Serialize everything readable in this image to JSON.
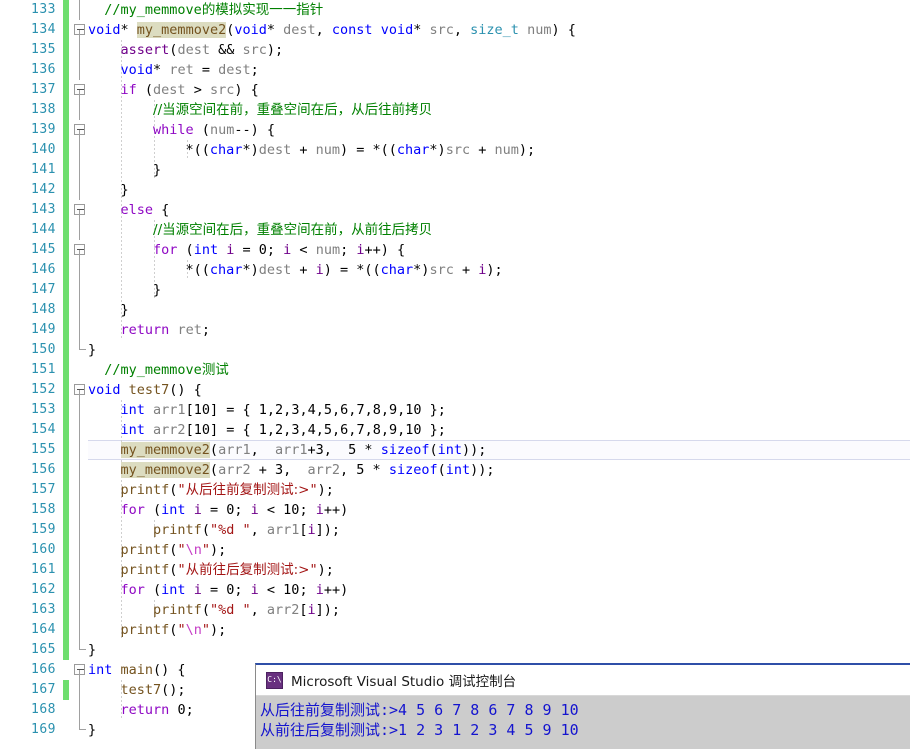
{
  "app": {
    "name": "visual-studio-code-editor",
    "accent_line_number_color": "#2B91AF",
    "change_bar_color": "#6EDE6E"
  },
  "editor": {
    "first_line_number": 133,
    "last_line_number": 169,
    "current_line_number": 155,
    "highlighted_symbol": "my_memmove2",
    "lines": [
      {
        "n": 133,
        "changed": true,
        "fold": "vline",
        "indent_guides": [],
        "html": "  <span class='cmt'>//my_memmove<span class='cjk'>的模拟实现一一指针</span></span>"
      },
      {
        "n": 134,
        "changed": true,
        "fold": "box",
        "indent_guides": [],
        "html": "<span class='kw'>void</span><span class='op'>*</span> <span class='fnhl'>my_memmove2</span>(<span class='kw'>void</span><span class='op'>*</span> <span class='var'>dest</span>, <span class='kw'>const</span> <span class='kw'>void</span><span class='op'>*</span> <span class='var'>src</span>, <span class='type'>size_t</span> <span class='var'>num</span>) {"
      },
      {
        "n": 135,
        "changed": true,
        "fold": "vline",
        "indent_guides": [
          1
        ],
        "html": "    <span class='macro'>assert</span>(<span class='var'>dest</span> &amp;&amp; <span class='var'>src</span>);"
      },
      {
        "n": 136,
        "changed": true,
        "fold": "vline",
        "indent_guides": [
          1
        ],
        "html": "    <span class='kw'>void</span><span class='op'>*</span> <span class='var'>ret</span> = <span class='var'>dest</span>;"
      },
      {
        "n": 137,
        "changed": true,
        "fold": "box",
        "indent_guides": [
          1
        ],
        "html": "    <span class='ctl'>if</span> (<span class='var'>dest</span> &gt; <span class='var'>src</span>) {"
      },
      {
        "n": 138,
        "changed": true,
        "fold": "vline",
        "indent_guides": [
          1,
          2
        ],
        "html": "        <span class='cmt cjk'>//当源空间在前，重叠空间在后，从后往前拷贝</span>"
      },
      {
        "n": 139,
        "changed": true,
        "fold": "box",
        "indent_guides": [
          1,
          2
        ],
        "html": "        <span class='ctl'>while</span> (<span class='var'>num</span>--) {"
      },
      {
        "n": 140,
        "changed": true,
        "fold": "vline",
        "indent_guides": [
          1,
          2,
          3
        ],
        "html": "            *((<span class='kw'>char</span>*)<span class='var'>dest</span> + <span class='var'>num</span>) = *((<span class='kw'>char</span>*)<span class='var'>src</span> + <span class='var'>num</span>);"
      },
      {
        "n": 141,
        "changed": true,
        "fold": "vline",
        "indent_guides": [
          1,
          2
        ],
        "html": "        }"
      },
      {
        "n": 142,
        "changed": true,
        "fold": "vline",
        "indent_guides": [
          1
        ],
        "html": "    }"
      },
      {
        "n": 143,
        "changed": true,
        "fold": "box",
        "indent_guides": [
          1
        ],
        "html": "    <span class='ctl'>else</span> {"
      },
      {
        "n": 144,
        "changed": true,
        "fold": "vline",
        "indent_guides": [
          1,
          2
        ],
        "html": "        <span class='cmt cjk'>//当源空间在后，重叠空间在前，从前往后拷贝</span>"
      },
      {
        "n": 145,
        "changed": true,
        "fold": "box",
        "indent_guides": [
          1,
          2
        ],
        "html": "        <span class='ctl'>for</span> (<span class='kw'>int</span> <span class='loc'>i</span> = <span class='num'>0</span>; <span class='loc'>i</span> &lt; <span class='var'>num</span>; <span class='loc'>i</span>++) {"
      },
      {
        "n": 146,
        "changed": true,
        "fold": "vline",
        "indent_guides": [
          1,
          2,
          3
        ],
        "html": "            *((<span class='kw'>char</span>*)<span class='var'>dest</span> + <span class='loc'>i</span>) = *((<span class='kw'>char</span>*)<span class='var'>src</span> + <span class='loc'>i</span>);"
      },
      {
        "n": 147,
        "changed": true,
        "fold": "vline",
        "indent_guides": [
          1,
          2
        ],
        "html": "        }"
      },
      {
        "n": 148,
        "changed": true,
        "fold": "vline",
        "indent_guides": [
          1
        ],
        "html": "    }"
      },
      {
        "n": 149,
        "changed": true,
        "fold": "vline",
        "indent_guides": [
          1
        ],
        "html": "    <span class='ctl'>return</span> <span class='var'>ret</span>;"
      },
      {
        "n": 150,
        "changed": true,
        "fold": "end",
        "indent_guides": [],
        "html": "}"
      },
      {
        "n": 151,
        "changed": true,
        "fold": "none",
        "indent_guides": [],
        "html": "  <span class='cmt'>//my_memmove<span class='cjk'>测试</span></span>"
      },
      {
        "n": 152,
        "changed": true,
        "fold": "box",
        "indent_guides": [],
        "html": "<span class='kw'>void</span> <span class='fn'>test7</span>() {"
      },
      {
        "n": 153,
        "changed": true,
        "fold": "vline",
        "indent_guides": [
          1
        ],
        "html": "    <span class='kw'>int</span> <span class='var'>arr1</span>[<span class='num'>10</span>] = { <span class='num'>1</span>,<span class='num'>2</span>,<span class='num'>3</span>,<span class='num'>4</span>,<span class='num'>5</span>,<span class='num'>6</span>,<span class='num'>7</span>,<span class='num'>8</span>,<span class='num'>9</span>,<span class='num'>10</span> };"
      },
      {
        "n": 154,
        "changed": true,
        "fold": "vline",
        "indent_guides": [
          1
        ],
        "html": "    <span class='kw'>int</span> <span class='var'>arr2</span>[<span class='num'>10</span>] = { <span class='num'>1</span>,<span class='num'>2</span>,<span class='num'>3</span>,<span class='num'>4</span>,<span class='num'>5</span>,<span class='num'>6</span>,<span class='num'>7</span>,<span class='num'>8</span>,<span class='num'>9</span>,<span class='num'>10</span> };"
      },
      {
        "n": 155,
        "changed": true,
        "fold": "vline",
        "indent_guides": [
          1
        ],
        "html": "    <span class='fnhl'>my_memmove2</span>(<span class='var'>arr1</span>,  <span class='var'>arr1</span>+<span class='num'>3</span>,  <span class='num'>5</span> * <span class='kw'>sizeof</span>(<span class='kw'>int</span>));"
      },
      {
        "n": 156,
        "changed": true,
        "fold": "vline",
        "indent_guides": [
          1
        ],
        "html": "    <span class='fnhl'>my_memmove2</span>(<span class='var'>arr2</span> + <span class='num'>3</span>,  <span class='var'>arr2</span>, <span class='num'>5</span> * <span class='kw'>sizeof</span>(<span class='kw'>int</span>));"
      },
      {
        "n": 157,
        "changed": true,
        "fold": "vline",
        "indent_guides": [
          1
        ],
        "html": "    <span class='fn'>printf</span>(<span class='str'>\"<span class='cjk'>从后往前复制测试:&gt;</span>\"</span>);"
      },
      {
        "n": 158,
        "changed": true,
        "fold": "vline",
        "indent_guides": [
          1
        ],
        "html": "    <span class='ctl'>for</span> (<span class='kw'>int</span> <span class='loc'>i</span> = <span class='num'>0</span>; <span class='loc'>i</span> &lt; <span class='num'>10</span>; <span class='loc'>i</span>++)"
      },
      {
        "n": 159,
        "changed": true,
        "fold": "vline",
        "indent_guides": [
          1,
          2
        ],
        "html": "        <span class='fn'>printf</span>(<span class='str'>\"%d \"</span>, <span class='var'>arr1</span>[<span class='loc'>i</span>]);"
      },
      {
        "n": 160,
        "changed": true,
        "fold": "vline",
        "indent_guides": [
          1
        ],
        "html": "    <span class='fn'>printf</span>(<span class='str'>\"<span class='esc'>\\n</span>\"</span>);"
      },
      {
        "n": 161,
        "changed": true,
        "fold": "vline",
        "indent_guides": [
          1
        ],
        "html": "    <span class='fn'>printf</span>(<span class='str'>\"<span class='cjk'>从前往后复制测试:&gt;</span>\"</span>);"
      },
      {
        "n": 162,
        "changed": true,
        "fold": "vline",
        "indent_guides": [
          1
        ],
        "html": "    <span class='ctl'>for</span> (<span class='kw'>int</span> <span class='loc'>i</span> = <span class='num'>0</span>; <span class='loc'>i</span> &lt; <span class='num'>10</span>; <span class='loc'>i</span>++)"
      },
      {
        "n": 163,
        "changed": true,
        "fold": "vline",
        "indent_guides": [
          1,
          2
        ],
        "html": "        <span class='fn'>printf</span>(<span class='str'>\"%d \"</span>, <span class='var'>arr2</span>[<span class='loc'>i</span>]);"
      },
      {
        "n": 164,
        "changed": true,
        "fold": "vline",
        "indent_guides": [
          1
        ],
        "html": "    <span class='fn'>printf</span>(<span class='str'>\"<span class='esc'>\\n</span>\"</span>);"
      },
      {
        "n": 165,
        "changed": true,
        "fold": "end",
        "indent_guides": [],
        "html": "}"
      },
      {
        "n": 166,
        "changed": false,
        "fold": "box",
        "indent_guides": [],
        "html": "<span class='kw'>int</span> <span class='fn'>main</span>() {"
      },
      {
        "n": 167,
        "changed": true,
        "fold": "vline",
        "indent_guides": [
          1
        ],
        "html": "    <span class='fn'>test7</span>();"
      },
      {
        "n": 168,
        "changed": false,
        "fold": "vline",
        "indent_guides": [
          1
        ],
        "html": "    <span class='ctl'>return</span> <span class='num'>0</span>;"
      },
      {
        "n": 169,
        "changed": false,
        "fold": "end",
        "indent_guides": [],
        "html": "}"
      }
    ]
  },
  "console": {
    "title": "Microsoft Visual Studio 调试控制台",
    "icon": "console-app-icon",
    "icon_glyph": "C:\\",
    "output_lines": [
      "从后往前复制测试:>4 5 6 7 8 6 7 8 9 10",
      "从前往后复制测试:>1 2 3 1 2 3 4 5 9 10"
    ],
    "text_color": "#1414CF",
    "background_color": "#CCCCCC"
  }
}
